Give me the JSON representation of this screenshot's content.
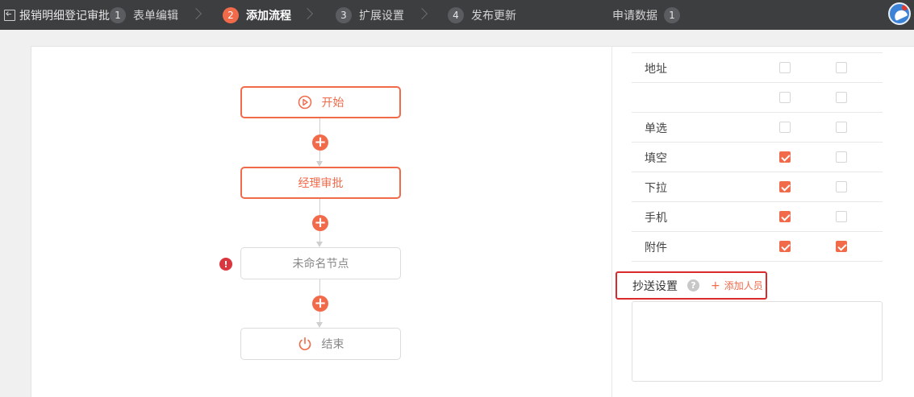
{
  "topbar": {
    "back_label": "报销明细登记审批",
    "steps": [
      {
        "num": "1",
        "label": "表单编辑"
      },
      {
        "num": "2",
        "label": "添加流程"
      },
      {
        "num": "3",
        "label": "扩展设置"
      },
      {
        "num": "4",
        "label": "发布更新"
      }
    ],
    "apply_data_label": "申请数据",
    "apply_data_count": "1"
  },
  "flow": {
    "nodes": [
      {
        "label": "开始",
        "icon": "play-circle-icon"
      },
      {
        "label": "经理审批"
      },
      {
        "label": "未命名节点",
        "warning": "!"
      },
      {
        "label": "结束",
        "icon": "power-icon"
      }
    ],
    "add_symbol": "+"
  },
  "fields": {
    "rows": [
      {
        "label": "地址",
        "col1": false,
        "col2": false
      },
      {
        "label": "",
        "col1": false,
        "col2": false
      },
      {
        "label": "单选",
        "col1": false,
        "col2": false
      },
      {
        "label": "填空",
        "col1": true,
        "col2": false
      },
      {
        "label": "下拉",
        "col1": true,
        "col2": false
      },
      {
        "label": "手机",
        "col1": true,
        "col2": false
      },
      {
        "label": "附件",
        "col1": true,
        "col2": true
      }
    ]
  },
  "cc": {
    "title": "抄送设置",
    "help_symbol": "?",
    "add_plus": "+",
    "add_label": "添加人员"
  },
  "colors": {
    "accent": "#f16a4a",
    "topbar": "#3d3e40",
    "highlight": "#d92b2b"
  }
}
